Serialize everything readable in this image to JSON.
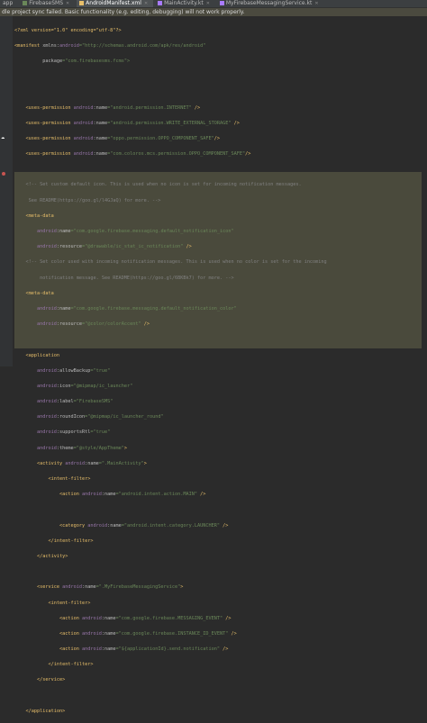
{
  "tabs": [
    {
      "label": "app",
      "active": false
    },
    {
      "label": "FirebaseSMS",
      "active": false
    },
    {
      "label": "AndroidManifest.xml",
      "active": true
    },
    {
      "label": "MainActivity.kt",
      "active": false
    },
    {
      "label": "MyFirebaseMessagingService.kt",
      "active": false
    }
  ],
  "notification": "dle project sync failed. Basic functionality (e.g. editing, debugging) will not work properly.",
  "code": {
    "l1": "<?xml version=\"1.0\" encoding=\"utf-8\"?>",
    "l2a": "<manifest ",
    "l2b": "xmlns:",
    "l2c": "android",
    "l2d": "=\"http://schemas.android.com/apk/res/android\"",
    "l3a": "package",
    "l3b": "=\"com.firebasesms.fcms\">",
    "perm1": "android.permission.INTERNET",
    "perm2": "android.permission.WRITE_EXTERNAL_STORAGE",
    "perm3": "oppo.permission.OPPO_COMPONENT_SAFE",
    "perm4": "com.coloros.mcs.permission.OPPO_COMPONENT_SAFE",
    "c1": "<!-- Set custom default icon. This is used when no icon is set for incoming notification messages.",
    "c2": "See README(https://goo.gl/l4GJaQ) for more. -->",
    "meta1name": "com.google.firebase.messaging.default_notification_icon",
    "meta1res": "@drawable/ic_stat_ic_notification",
    "c3": "<!-- Set color used with incoming notification messages. This is used when no color is set for the incoming",
    "c4": "notification message. See README(https://goo.gl/6BKBk7) for more. -->",
    "meta2name": "com.google.firebase.messaging.default_notification_color",
    "meta2res": "@color/colorAccent",
    "app_backup": "true",
    "app_icon": "@mipmap/ic_launcher",
    "app_label": "FirebaseSMS",
    "app_round": "@mipmap/ic_launcher_round",
    "app_rtl": "true",
    "app_theme": "@style/AppTheme",
    "activity_name": ".MainActivity",
    "action_main": "android.intent.action.MAIN",
    "category_launcher": "android.intent.category.LAUNCHER",
    "service_name": ".MyFirebaseMessagingService",
    "action_event": "com.google.firebase.MESSAGING_EVENT",
    "action_id": "com.google.firebase.INSTANCE_ID_EVENT",
    "action_send": "${applicationId}.send.notification"
  }
}
